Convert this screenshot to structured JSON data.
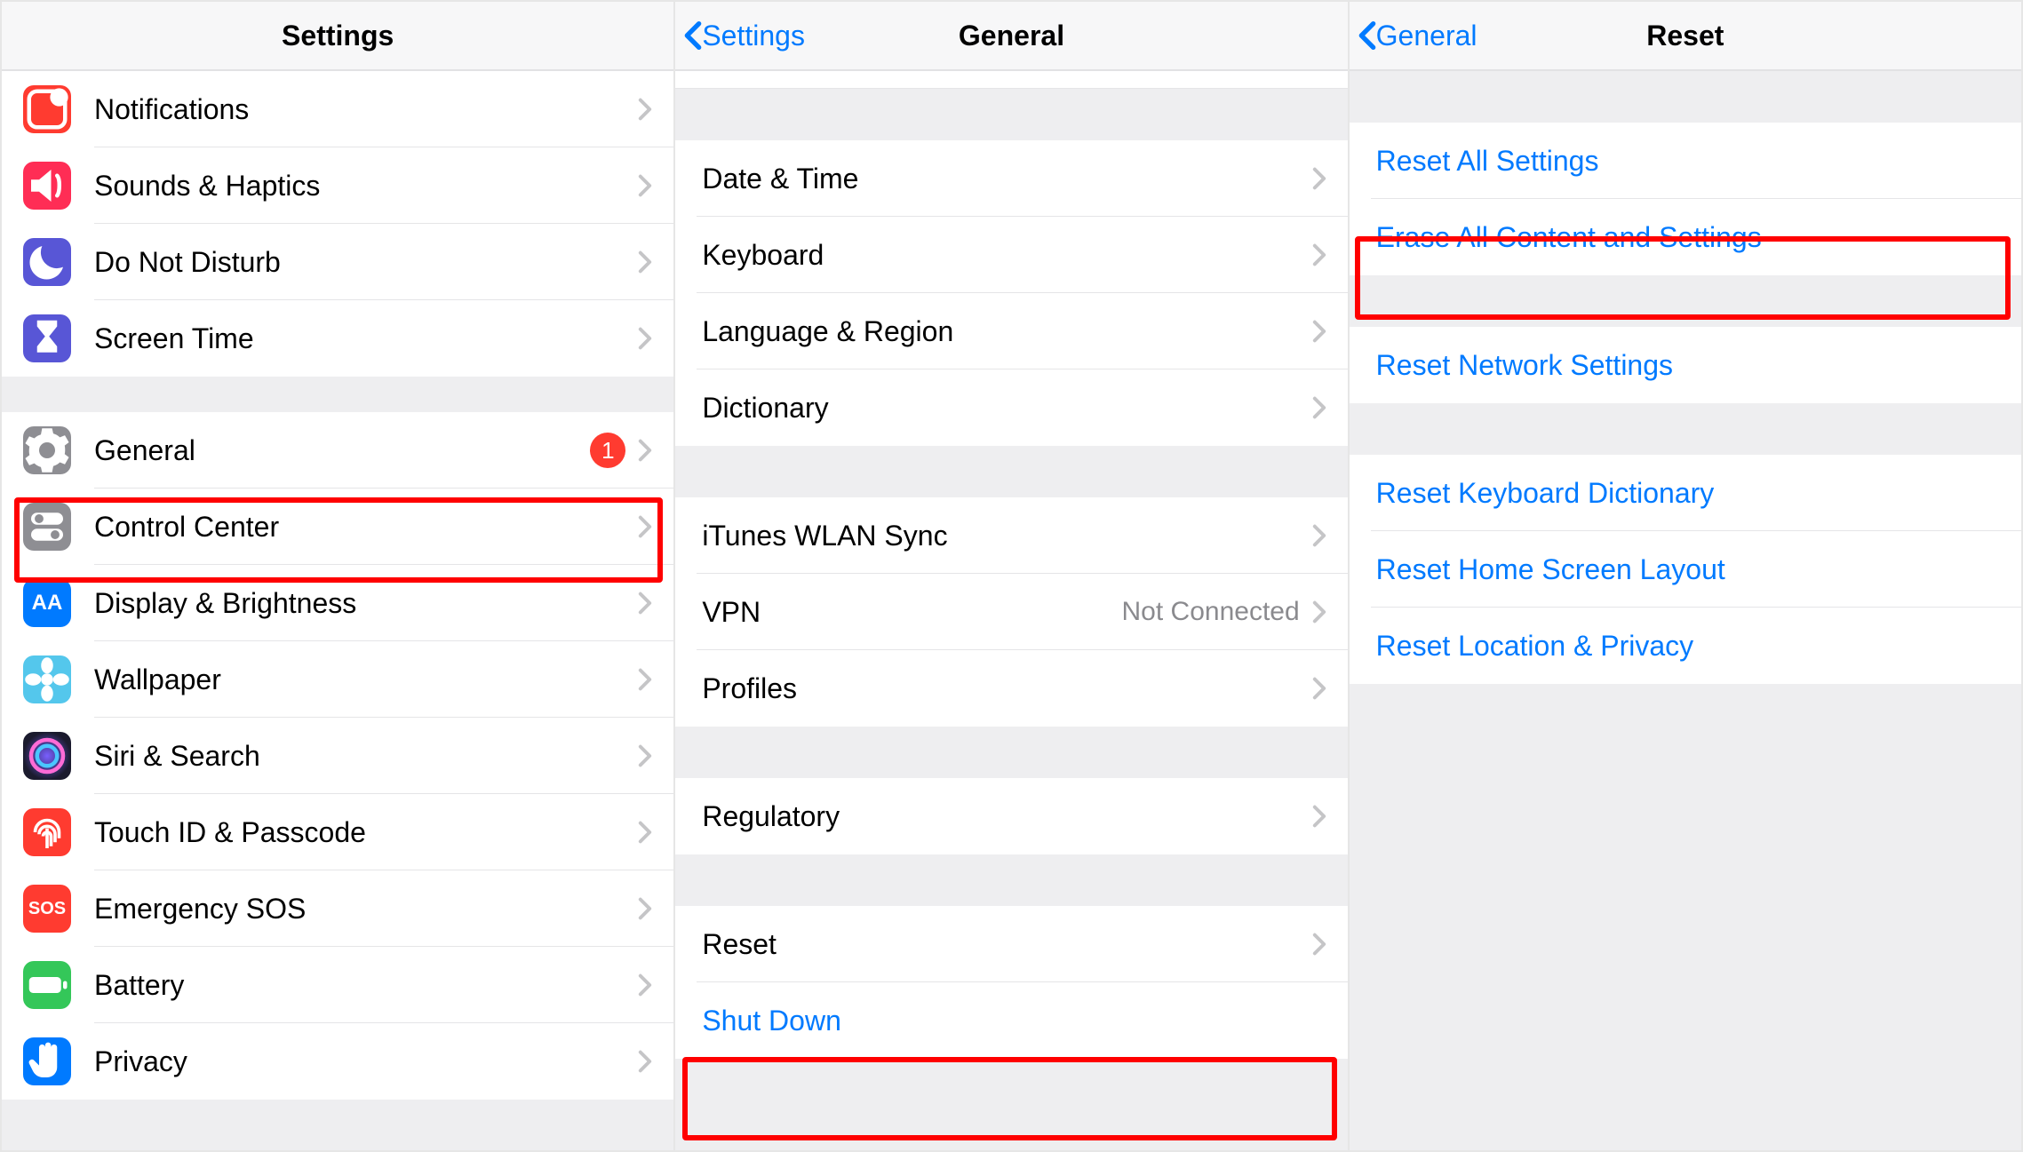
{
  "panes": {
    "settings": {
      "title": "Settings",
      "group1": [
        {
          "label": "Notifications",
          "icon": "notifications-icon",
          "color": "#ff3b30"
        },
        {
          "label": "Sounds & Haptics",
          "icon": "sounds-icon",
          "color": "#ff2d55"
        },
        {
          "label": "Do Not Disturb",
          "icon": "moon-icon",
          "color": "#5856d6"
        },
        {
          "label": "Screen Time",
          "icon": "hourglass-icon",
          "color": "#5856d6"
        }
      ],
      "group2": [
        {
          "label": "General",
          "icon": "gear-icon",
          "color": "#8e8e93",
          "badge": "1"
        },
        {
          "label": "Control Center",
          "icon": "switches-icon",
          "color": "#8e8e93"
        },
        {
          "label": "Display & Brightness",
          "icon": "aa-icon",
          "color": "#007aff"
        },
        {
          "label": "Wallpaper",
          "icon": "flower-icon",
          "color": "#54c7ec"
        },
        {
          "label": "Siri & Search",
          "icon": "siri-icon",
          "color": "#1b1b2e"
        },
        {
          "label": "Touch ID & Passcode",
          "icon": "fingerprint-icon",
          "color": "#ff3b30"
        },
        {
          "label": "Emergency SOS",
          "icon": "sos-icon",
          "color": "#ff3b30"
        },
        {
          "label": "Battery",
          "icon": "battery-icon",
          "color": "#34c759"
        },
        {
          "label": "Privacy",
          "icon": "hand-icon",
          "color": "#007aff"
        }
      ]
    },
    "general": {
      "back_label": "Settings",
      "title": "General",
      "groupA": [
        {
          "label": "Date & Time"
        },
        {
          "label": "Keyboard"
        },
        {
          "label": "Language & Region"
        },
        {
          "label": "Dictionary"
        }
      ],
      "groupB": [
        {
          "label": "iTunes WLAN Sync"
        },
        {
          "label": "VPN",
          "value": "Not Connected"
        },
        {
          "label": "Profiles"
        }
      ],
      "groupC": [
        {
          "label": "Regulatory"
        }
      ],
      "groupD": [
        {
          "label": "Reset"
        },
        {
          "label": "Shut Down",
          "blue": true,
          "no_chevron": true
        }
      ]
    },
    "reset": {
      "back_label": "General",
      "title": "Reset",
      "groupA": [
        {
          "label": "Reset All Settings"
        },
        {
          "label": "Erase All Content and Settings"
        }
      ],
      "groupB": [
        {
          "label": "Reset Network Settings"
        }
      ],
      "groupC": [
        {
          "label": "Reset Keyboard Dictionary"
        },
        {
          "label": "Reset Home Screen Layout"
        },
        {
          "label": "Reset Location & Privacy"
        }
      ]
    }
  },
  "ui": {
    "chevron_color": "#c5c5c7",
    "back_chevron_color": "#007aff"
  }
}
